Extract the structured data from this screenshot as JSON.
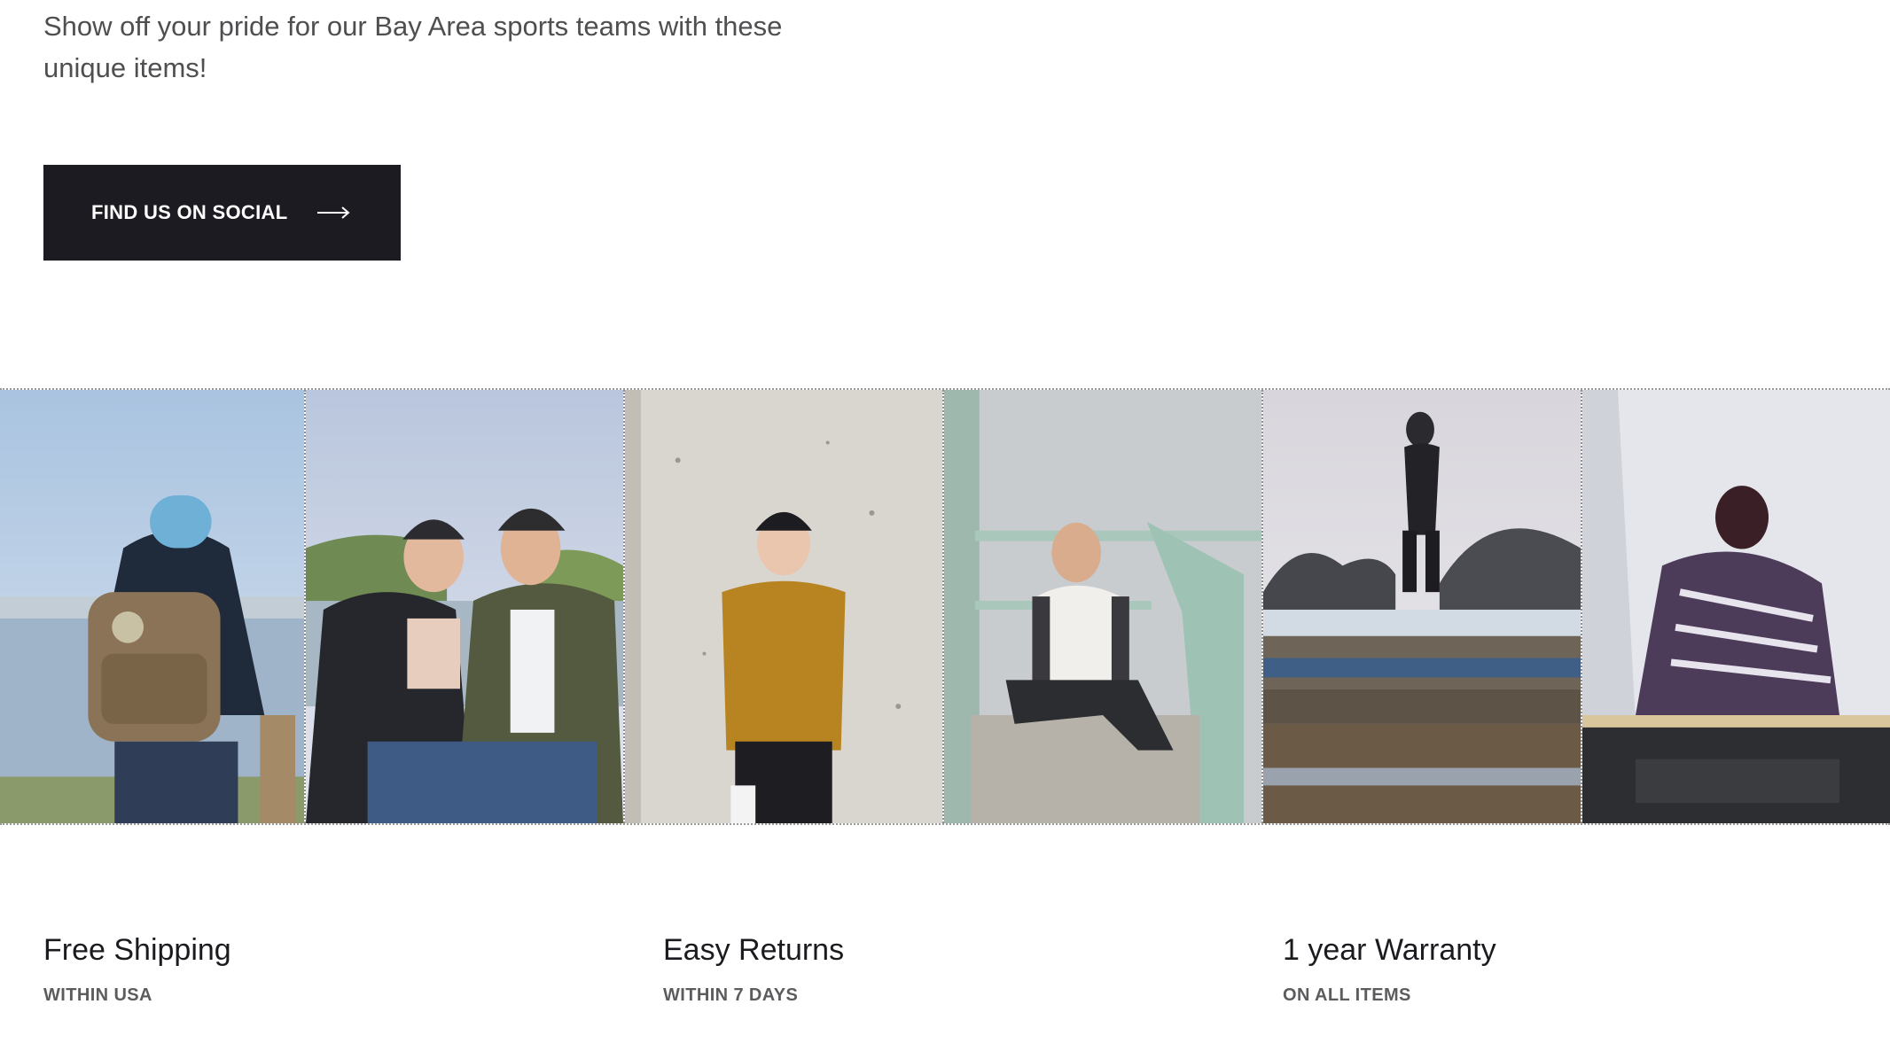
{
  "hero": {
    "tagline": "Show off your pride for our Bay Area sports teams with these unique items!",
    "cta_label": "FIND US ON SOCIAL",
    "cta_icon": "arrow-right-icon"
  },
  "gallery": {
    "tiles": [
      {
        "name": "photo-backpack-beanie"
      },
      {
        "name": "photo-couple-caps"
      },
      {
        "name": "photo-man-yellow-shirt"
      },
      {
        "name": "photo-man-lifeguard-tower"
      },
      {
        "name": "photo-woman-on-rocks"
      },
      {
        "name": "photo-woman-blanket-car"
      }
    ]
  },
  "features": [
    {
      "title": "Free Shipping",
      "subtitle": "WITHIN USA"
    },
    {
      "title": "Easy Returns",
      "subtitle": "WITHIN 7 DAYS"
    },
    {
      "title": "1 year Warranty",
      "subtitle": "ON ALL ITEMS"
    }
  ],
  "colors": {
    "button_bg": "#1c1b21",
    "text_dark": "#1b1a1f",
    "text_muted": "#5c5c5f"
  }
}
